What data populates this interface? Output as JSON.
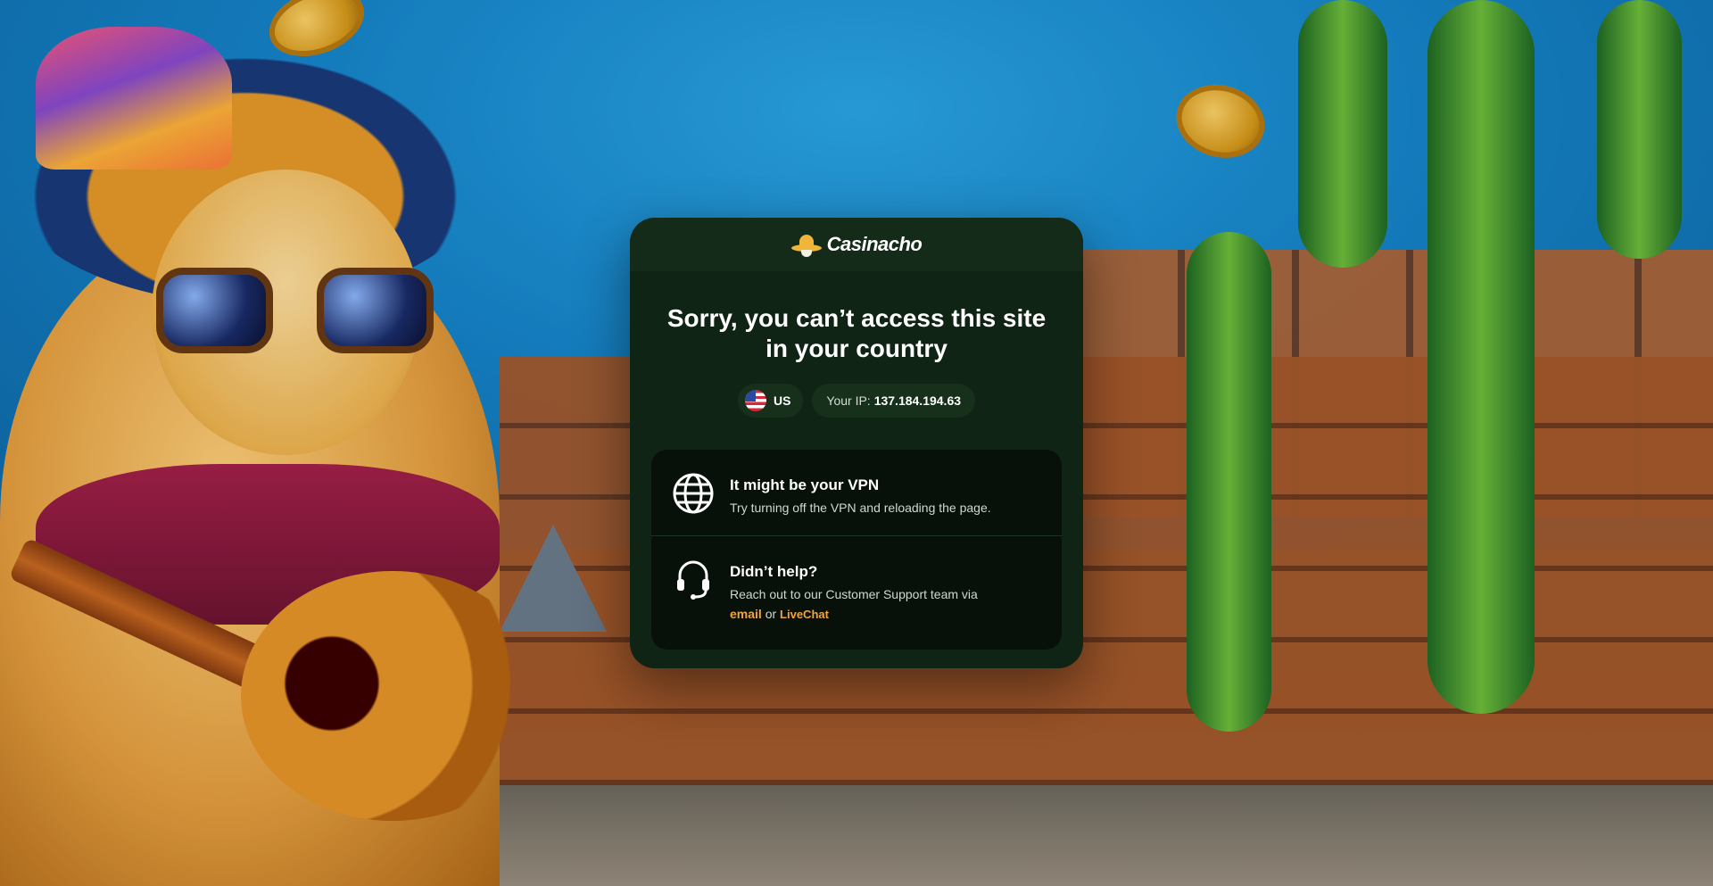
{
  "brand": {
    "name": "Casinacho",
    "logo_icon": "sombrero-mustache-icon"
  },
  "page": {
    "title": "Sorry, you can’t access this site in your country"
  },
  "location": {
    "country_code": "US",
    "flag_icon": "us-flag-icon",
    "ip_label": "Your IP:",
    "ip_value": "137.184.194.63"
  },
  "help": {
    "items": [
      {
        "icon": "globe-icon",
        "heading": "It might be your VPN",
        "text": "Try turning off the VPN and reloading the page."
      },
      {
        "icon": "headset-icon",
        "heading": "Didn’t help?",
        "text": "Reach out to our Customer Support team via",
        "email_link": "email",
        "or_text": "or",
        "chat_link": "LiveChat"
      }
    ]
  },
  "colors": {
    "card_bg": "#0f2414",
    "card_header_bg": "#142b19",
    "inner_panel_bg": "#081109",
    "accent_link": "#f2a53a",
    "text_primary": "#ffffff"
  }
}
